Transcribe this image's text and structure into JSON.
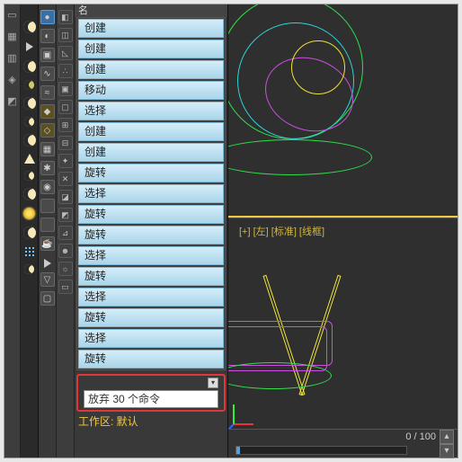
{
  "header_label": "名",
  "history": {
    "items": [
      "创建",
      "创建",
      "创建",
      "移动",
      "选择",
      "创建",
      "创建",
      "旋转",
      "选择",
      "旋转",
      "旋转",
      "选择",
      "旋转",
      "选择",
      "旋转",
      "选择",
      "旋转"
    ]
  },
  "command_input": {
    "text": "放弃 30 个命令"
  },
  "status_bar": "工作区: 默认",
  "viewport2": {
    "label": "[+] [左] [标准] [线框]"
  },
  "timeline": {
    "display": "0 / 100"
  },
  "left_shelf": {
    "icons": [
      "door",
      "grid",
      "panel",
      "sq",
      "mod",
      "sq",
      "sq",
      "sq",
      "sq"
    ]
  },
  "tool_col_a": {
    "icons": [
      "sphere",
      "bulb",
      "cam",
      "spline",
      "wave",
      "sel",
      "sel2",
      "grid",
      "snow",
      "eye",
      "blank",
      "blank",
      "teapot",
      "paint",
      "funnel",
      "cal"
    ]
  },
  "tool_col_b": {
    "icons": [
      "cube",
      "ruler",
      "helper",
      "particle",
      "shape",
      "dummy",
      "spacer",
      "bone",
      "sys",
      "cross",
      "iso",
      "iso2",
      "measure",
      "char",
      "light",
      "group"
    ]
  },
  "colors": {
    "accent": "#aad5e9",
    "highlight": "#f5c842",
    "wire_green": "#2fe04d",
    "wire_cyan": "#2ad6d6",
    "wire_magenta": "#cc4fe0",
    "wire_yellow": "#efe237"
  }
}
